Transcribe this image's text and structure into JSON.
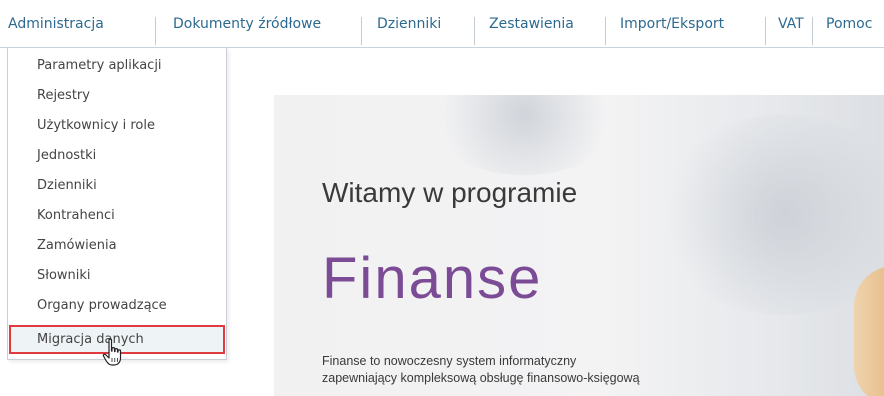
{
  "menu": {
    "items": [
      {
        "label": "Administracja"
      },
      {
        "label": "Dokumenty źródłowe"
      },
      {
        "label": "Dzienniki"
      },
      {
        "label": "Zestawienia"
      },
      {
        "label": "Import/Eksport"
      },
      {
        "label": "VAT"
      },
      {
        "label": "Pomoc"
      }
    ]
  },
  "dropdown": {
    "items": [
      {
        "label": "Parametry aplikacji"
      },
      {
        "label": "Rejestry"
      },
      {
        "label": "Użytkownicy i role"
      },
      {
        "label": "Jednostki"
      },
      {
        "label": "Dzienniki"
      },
      {
        "label": "Kontrahenci"
      },
      {
        "label": "Zamówienia"
      },
      {
        "label": "Słowniki"
      },
      {
        "label": "Organy prowadzące"
      },
      {
        "label": "Migracja danych"
      }
    ],
    "highlighted_index": 9
  },
  "hero": {
    "welcome": "Witamy w programie",
    "product": "Finanse",
    "description_line1": "Finanse to nowoczesny system informatyczny",
    "description_line2": "zapewniający kompleksową obsługę finansowo-księgową"
  },
  "colors": {
    "menu_text": "#2d6a8f",
    "product_accent": "#7b4b96",
    "highlight_border": "#e0393e"
  },
  "icons": {
    "cursor": "hand-pointer-icon"
  }
}
